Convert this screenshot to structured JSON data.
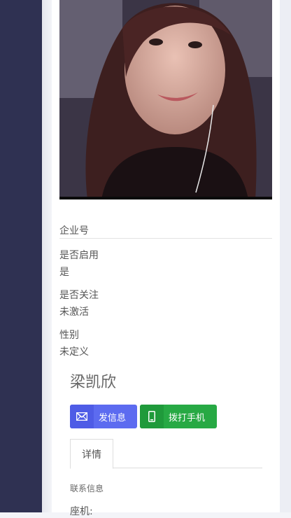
{
  "profile": {
    "name": "梁凯欣",
    "fields": [
      {
        "label": "企业号",
        "value": ""
      },
      {
        "label": "是否启用",
        "value": "是"
      },
      {
        "label": "是否关注",
        "value": "未激活"
      },
      {
        "label": "性别",
        "value": "未定义"
      }
    ]
  },
  "actions": {
    "message_label": "发信息",
    "call_label": "拨打手机"
  },
  "tabs": [
    {
      "label": "详情",
      "active": true
    }
  ],
  "details": {
    "section_title": "联系信息",
    "landline_label": "座机:"
  },
  "icons": {
    "message": "mail-icon",
    "call": "mobile-phone-icon"
  },
  "colors": {
    "sidebar": "#2f3152",
    "message_button": "#5c6bf0",
    "call_button": "#27a944"
  }
}
